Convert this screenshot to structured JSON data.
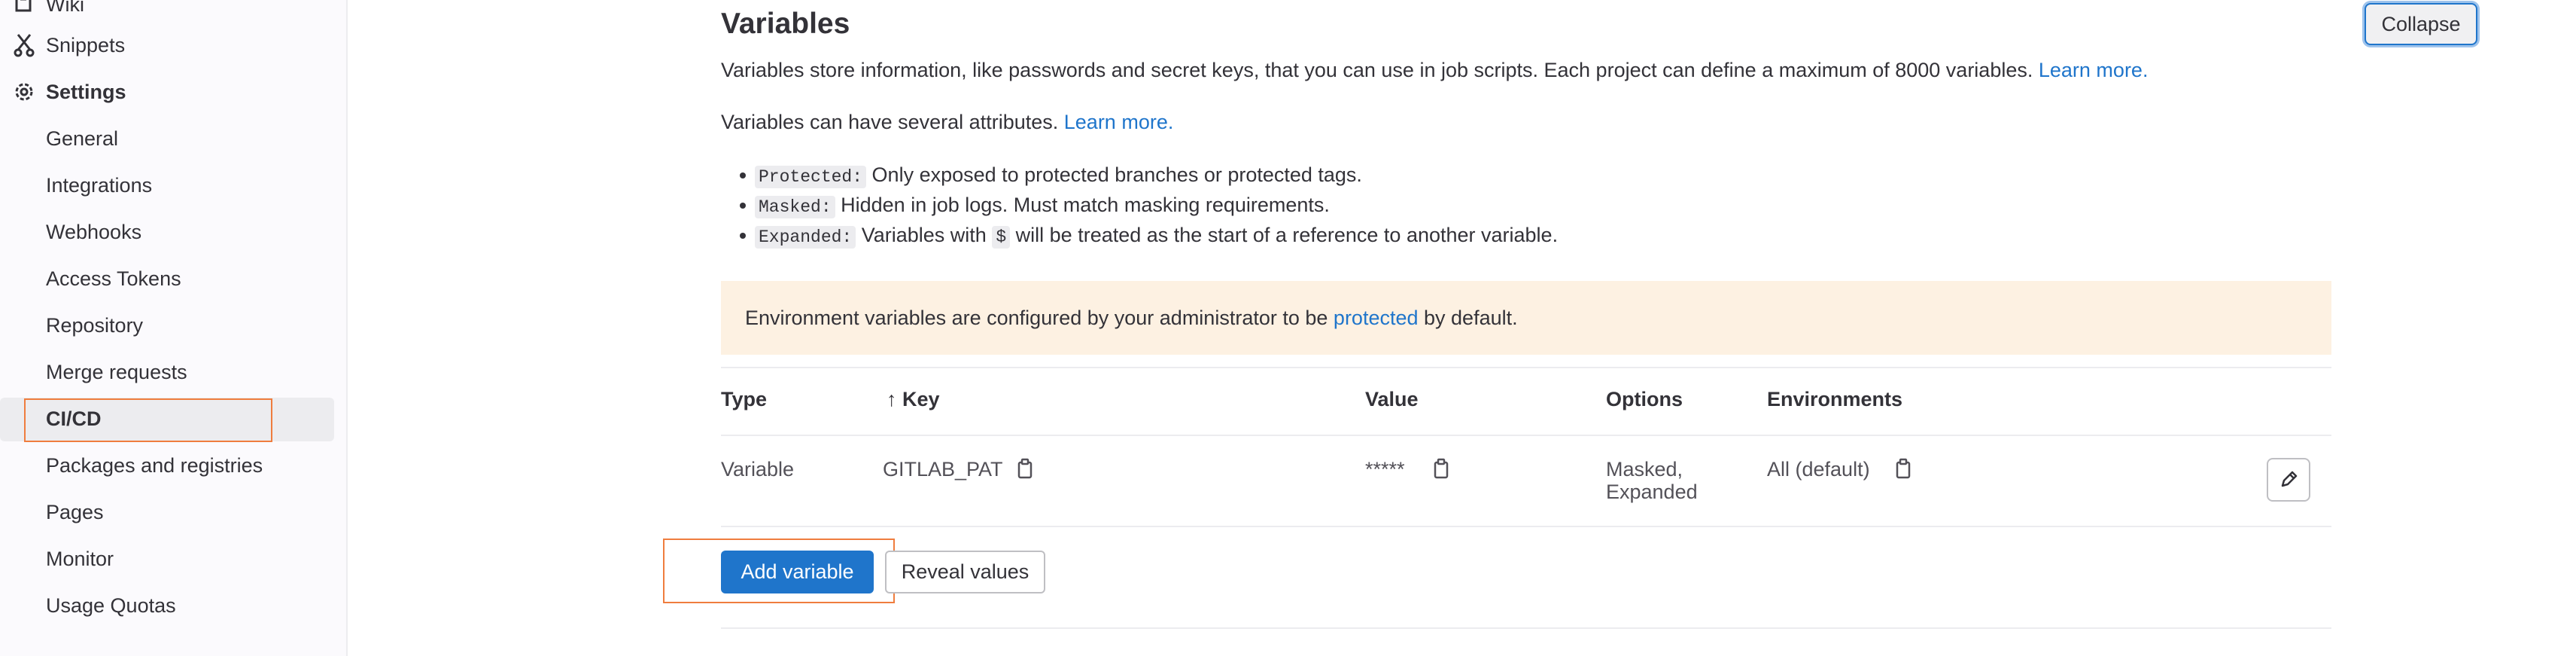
{
  "sidebar": {
    "wiki": "Wiki",
    "snippets": "Snippets",
    "settings": "Settings",
    "items": [
      {
        "label": "General"
      },
      {
        "label": "Integrations"
      },
      {
        "label": "Webhooks"
      },
      {
        "label": "Access Tokens"
      },
      {
        "label": "Repository"
      },
      {
        "label": "Merge requests"
      },
      {
        "label": "CI/CD",
        "active": true
      },
      {
        "label": "Packages and registries"
      },
      {
        "label": "Pages"
      },
      {
        "label": "Monitor"
      },
      {
        "label": "Usage Quotas"
      }
    ],
    "icons": {
      "wiki": "book-icon",
      "snippets": "scissors-icon",
      "settings": "gear-icon"
    }
  },
  "variables": {
    "title": "Variables",
    "collapse_label": "Collapse",
    "description": "Variables store information, like passwords and secret keys, that you can use in job scripts. Each project can define a maximum of 8000 variables.",
    "description_link": "Learn more.",
    "attributes_intro": "Variables can have several attributes.",
    "attributes_link": "Learn more.",
    "attributes": [
      {
        "code": "Protected:",
        "text": "Only exposed to protected branches or protected tags."
      },
      {
        "code": "Masked:",
        "text": "Hidden in job logs. Must match masking requirements."
      },
      {
        "code": "Expanded:",
        "text_before": "Variables with",
        "inline_code": "$",
        "text_after": "will be treated as the start of a reference to another variable."
      }
    ],
    "alert": {
      "text_before": "Environment variables are configured by your administrator to be",
      "link": "protected",
      "text_after": "by default."
    },
    "table": {
      "headers": {
        "type": "Type",
        "sort_arrow": "↑",
        "key": "Key",
        "value": "Value",
        "options": "Options",
        "environments": "Environments"
      },
      "rows": [
        {
          "type": "Variable",
          "key": "GITLAB_PAT",
          "value": "*****",
          "options_line1": "Masked,",
          "options_line2": "Expanded",
          "environment": "All (default)"
        }
      ]
    },
    "add_variable_label": "Add variable",
    "reveal_values_label": "Reveal values"
  },
  "colors": {
    "accent": "#1f75cb",
    "highlight": "#ef7d3e",
    "alert_bg": "#fdf1e2"
  }
}
